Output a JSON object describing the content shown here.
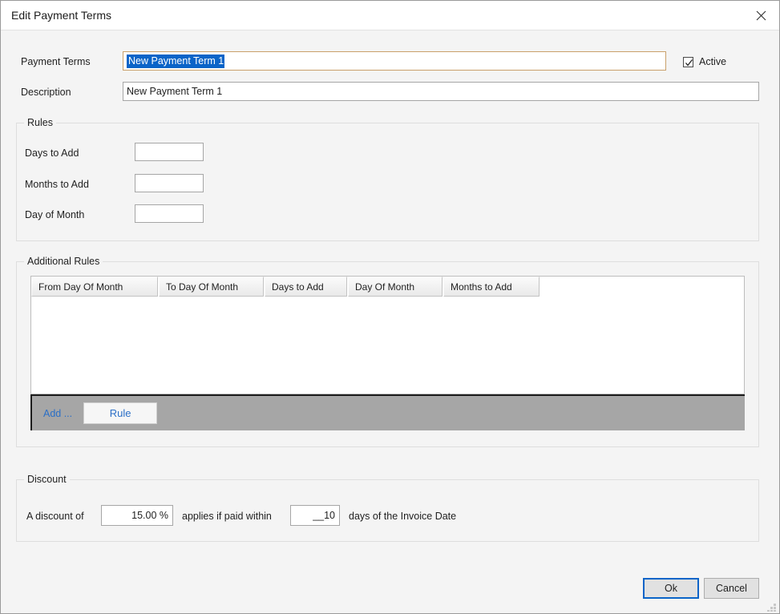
{
  "window": {
    "title": "Edit Payment Terms",
    "close_icon": "close-icon",
    "resize_grip": "resize-grip-icon"
  },
  "form": {
    "payment_terms": {
      "label": "Payment Terms",
      "value": "New Payment Term 1",
      "selected": true
    },
    "description": {
      "label": "Description",
      "value": "New Payment Term 1"
    },
    "active": {
      "label": "Active",
      "checked": true
    }
  },
  "rules": {
    "title": "Rules",
    "fields": [
      {
        "label": "Days to Add",
        "value": ""
      },
      {
        "label": "Months to Add",
        "value": ""
      },
      {
        "label": "Day of Month",
        "value": ""
      }
    ]
  },
  "additional_rules": {
    "title": "Additional Rules",
    "columns": [
      "From Day Of Month",
      "To Day Of Month",
      "Days to Add",
      "Day Of Month",
      "Months to Add"
    ],
    "rows": [],
    "toolbar": {
      "add_label": "Add ...",
      "rule_label": "Rule"
    }
  },
  "discount": {
    "title": "Discount",
    "prefix_text": "A discount of",
    "percent_value": "15.00 %",
    "middle_text": "applies if paid within",
    "days_value": "__10",
    "suffix_text": "days of the Invoice Date"
  },
  "footer": {
    "ok_label": "Ok",
    "cancel_label": "Cancel"
  },
  "colors": {
    "accent": "#0a64c8",
    "link": "#2b6fc6",
    "toolbar_bg": "#a6a6a6",
    "dialog_bg": "#f4f4f4"
  }
}
